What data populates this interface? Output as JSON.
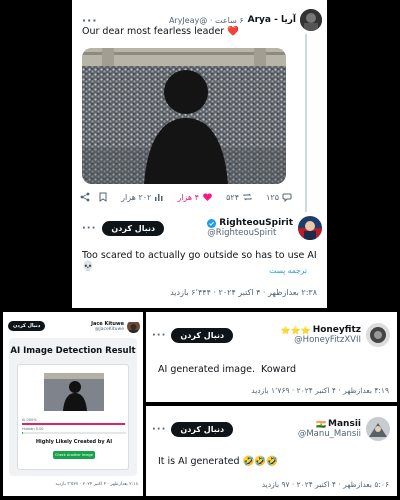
{
  "main_tweet": {
    "author_name": "Arya - آریا",
    "author_handle": "@AryJeay",
    "time": "۶ ساعت",
    "text": "Our dear most fearless leader",
    "heart": "❤️",
    "stats": {
      "replies": "۱۲۵",
      "retweets": "۵۲۴",
      "likes": "۴ هزار",
      "views": "۲۰۲ هزار"
    }
  },
  "reply_main": {
    "name": "RighteouSpirit",
    "handle": "@RighteouSpirit",
    "follow_label": "دنبال کردن",
    "text": "Too scared to actually go outside so has to use AI 💀",
    "translate": "ترجمه پست",
    "meta": "۲:۳۸ بعدازظهر · ۴ اکتبر ۲۰۲۴ · ۶٬۴۴۴ بازدید"
  },
  "reply_jace": {
    "name": "Jace Kituwe",
    "handle": "@JaceKituwe",
    "follow_label": "دنبال کردن",
    "meta": "۲:۱۸ بعدازظهر · ۴ اکتبر ۲۰۲۴ · ۳٬۵۲۷ بازدید",
    "panel": {
      "title": "AI Image Detection Result",
      "ai_label": "AI 000%",
      "human_label": "Human 0.00",
      "verdict": "Highly Likely Created by AI",
      "button": "Check Another Image",
      "ai_fraction": 0.99,
      "human_fraction": 0.01
    }
  },
  "reply_honey": {
    "stars": "⭐⭐⭐",
    "name": "Honeyfitz",
    "handle": "@HoneyFitzXVII",
    "follow_label": "دنبال کردن",
    "text": "AI generated image.  Koward",
    "meta": "۴:۱۹ بعدازظهر · ۴ اکتبر ۲۰۲۴ · ۱٬۷۶۹ بازدید"
  },
  "reply_mansii": {
    "flag": "🇮🇳",
    "name": "Mansii",
    "handle": "@Manu_Mansii",
    "follow_label": "دنبال کردن",
    "text": "It is AI generated 🤣🤣🤣",
    "meta": "۵:۰۶ بعدازظهر · ۴ اکتبر ۲۰۲۴ · ۹۷ بازدید"
  },
  "colors": {
    "verified": "#1d9bf0",
    "like": "#f91880",
    "dark_btn": "#0f1419",
    "muted": "#536471",
    "link": "#1d9bf0"
  }
}
